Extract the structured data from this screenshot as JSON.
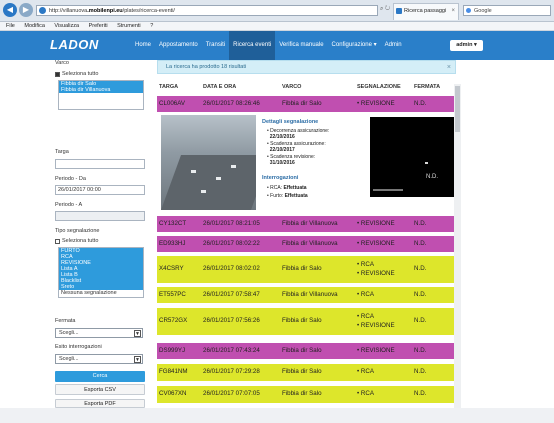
{
  "browser": {
    "url_prefix": "http://villanuova",
    "url_host": ".mobilenpi.eu",
    "url_path": "/plates/ricerca-eventi/",
    "tab_title": "Ricerca passaggi",
    "search_placeholder": "Google",
    "menu": [
      "File",
      "Modifica",
      "Visualizza",
      "Preferiti",
      "Strumenti",
      "?"
    ]
  },
  "app": {
    "logo": "LADON",
    "nav": [
      "Home",
      "Appostamento",
      "Transiti",
      "Ricerca eventi",
      "Verifica manuale",
      "Configurazione ▾",
      "Admin"
    ],
    "active_nav": "Ricerca eventi",
    "user_button": "admin ▾"
  },
  "sidebar": {
    "varco_label": "Varco",
    "select_all_label": "Seleziona tutto",
    "varco_options": [
      "Fibbia dir Salo",
      "Fibbia dir Villanuova"
    ],
    "targa_label": "Targa",
    "targa_value": "",
    "periodo_da_label": "Periodo - Da",
    "periodo_da_value": "26/01/2017 00:00",
    "periodo_a_label": "Periodo - A",
    "periodo_a_value": "",
    "tipo_label": "Tipo segnalazione",
    "tipo_select_all_label": "Seleziona tutto",
    "tipo_options": [
      "FURTO",
      "RCA",
      "REVISIONE",
      "Lista A",
      "Lista B",
      "Blacklist",
      "Sreto",
      "Nessuna segnalazione"
    ],
    "fermata_label": "Fermata",
    "fermata_value": "Scegli...",
    "esito_label": "Esito interrogazioni",
    "esito_value": "Scegli...",
    "cerca_button": "Cerca",
    "export_csv_button": "Esporta CSV",
    "export_pdf_button": "Esporta PDF"
  },
  "main": {
    "alert_text": "La ricerca ha prodotto 18 risultati",
    "columns": [
      "TARGA",
      "DATA E ORA",
      "VARCO",
      "SEGNALAZIONE",
      "FERMATA"
    ],
    "first_row": {
      "targa": "CL006AV",
      "data": "26/01/2017 08:26:46",
      "varco": "Fibbia dir Salo",
      "segnalazione": [
        "REVISIONE"
      ],
      "fermata": "N.D."
    },
    "detail": {
      "section1": "Dettagli segnalazione",
      "items": [
        {
          "label": "Decorrenza assicurazione:",
          "value": "22/10/2016"
        },
        {
          "label": "Scadenza assicurazione:",
          "value": "22/10/2017"
        },
        {
          "label": "Scadenza revisione:",
          "value": "31/10/2016"
        }
      ],
      "section2": "Interrogazioni",
      "queries": [
        {
          "label": "RCA:",
          "value": "Effettuata"
        },
        {
          "label": "Furto:",
          "value": "Effettuata"
        }
      ],
      "image_caption": "N.D."
    },
    "rows": [
      {
        "targa": "CY132CT",
        "data": "26/01/2017 08:21:05",
        "varco": "Fibbia dir Villanuova",
        "segnalazione": [
          "REVISIONE"
        ],
        "fermata": "N.D."
      },
      {
        "targa": "ED933HJ",
        "data": "26/01/2017 08:02:22",
        "varco": "Fibbia dir Villanuova",
        "segnalazione": [
          "REVISIONE"
        ],
        "fermata": "N.D."
      },
      {
        "targa": "X4CSRY",
        "data": "26/01/2017 08:02:02",
        "varco": "Fibbia dir Salo",
        "segnalazione": [
          "RCA",
          "REVISIONE"
        ],
        "fermata": "N.D."
      },
      {
        "targa": "ET557PC",
        "data": "26/01/2017 07:58:47",
        "varco": "Fibbia dir Villanuova",
        "segnalazione": [
          "RCA"
        ],
        "fermata": "N.D."
      },
      {
        "targa": "CR572GX",
        "data": "26/01/2017 07:56:26",
        "varco": "Fibbia dir Salo",
        "segnalazione": [
          "RCA",
          "REVISIONE"
        ],
        "fermata": "N.D."
      },
      {
        "targa": "DS999YJ",
        "data": "26/01/2017 07:43:24",
        "varco": "Fibbia dir Salo",
        "segnalazione": [
          "REVISIONE"
        ],
        "fermata": "N.D."
      },
      {
        "targa": "FG841NM",
        "data": "26/01/2017 07:29:28",
        "varco": "Fibbia dir Salo",
        "segnalazione": [
          "RCA"
        ],
        "fermata": "N.D."
      },
      {
        "targa": "CV067XN",
        "data": "26/01/2017 07:07:05",
        "varco": "Fibbia dir Salo",
        "segnalazione": [
          "RCA"
        ],
        "fermata": "N.D."
      }
    ]
  },
  "colors": {
    "navbar": "#2a7fc9",
    "revisione_row": "#c04fb0",
    "rca_row": "#dde62b",
    "alert_bg": "#d4eef7",
    "primary_button": "#2e9bdc"
  }
}
